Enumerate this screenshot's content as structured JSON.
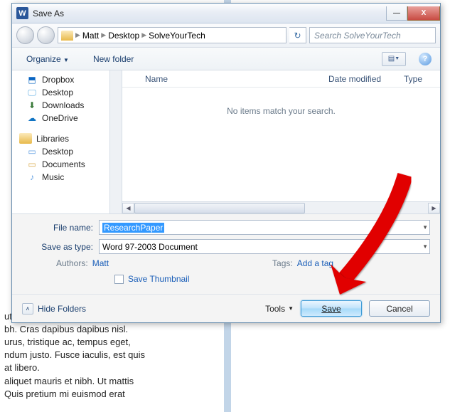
{
  "window": {
    "title": "Save As",
    "min": "—",
    "close": "X"
  },
  "path": {
    "seg1": "Matt",
    "seg2": "Desktop",
    "seg3": "SolveYourTech"
  },
  "search": {
    "placeholder": "Search SolveYourTech"
  },
  "toolbar": {
    "organize": "Organize",
    "newfolder": "New folder"
  },
  "tree": {
    "dropbox": "Dropbox",
    "desktop": "Desktop",
    "downloads": "Downloads",
    "onedrive": "OneDrive",
    "libraries": "Libraries",
    "lib_desktop": "Desktop",
    "lib_documents": "Documents",
    "lib_music": "Music"
  },
  "columns": {
    "name": "Name",
    "date": "Date modified",
    "type": "Type"
  },
  "empty": "No items match your search.",
  "form": {
    "filename_label": "File name:",
    "filename_value": "ResearchPaper",
    "saveastype_label": "Save as type:",
    "saveastype_value": "Word 97-2003 Document",
    "authors_label": "Authors:",
    "authors_value": "Matt",
    "tags_label": "Tags:",
    "tags_value": "Add a tag",
    "thumbnail": "Save Thumbnail"
  },
  "buttons": {
    "hide": "Hide Folders",
    "tools": "Tools",
    "save": "Save",
    "cancel": "Cancel"
  },
  "bgtext": {
    "l1": "utpat urna. Mauris eleifend nulla eget",
    "l2": "bh. Cras dapibus dapibus nisl.",
    "l3": "urus, tristique ac, tempus eget,",
    "l4": "ndum justo. Fusce iaculis, est quis",
    "l5": "at libero.",
    "l6": "aliquet mauris et nibh. Ut mattis",
    "l7": "Quis pretium mi euismod erat"
  }
}
